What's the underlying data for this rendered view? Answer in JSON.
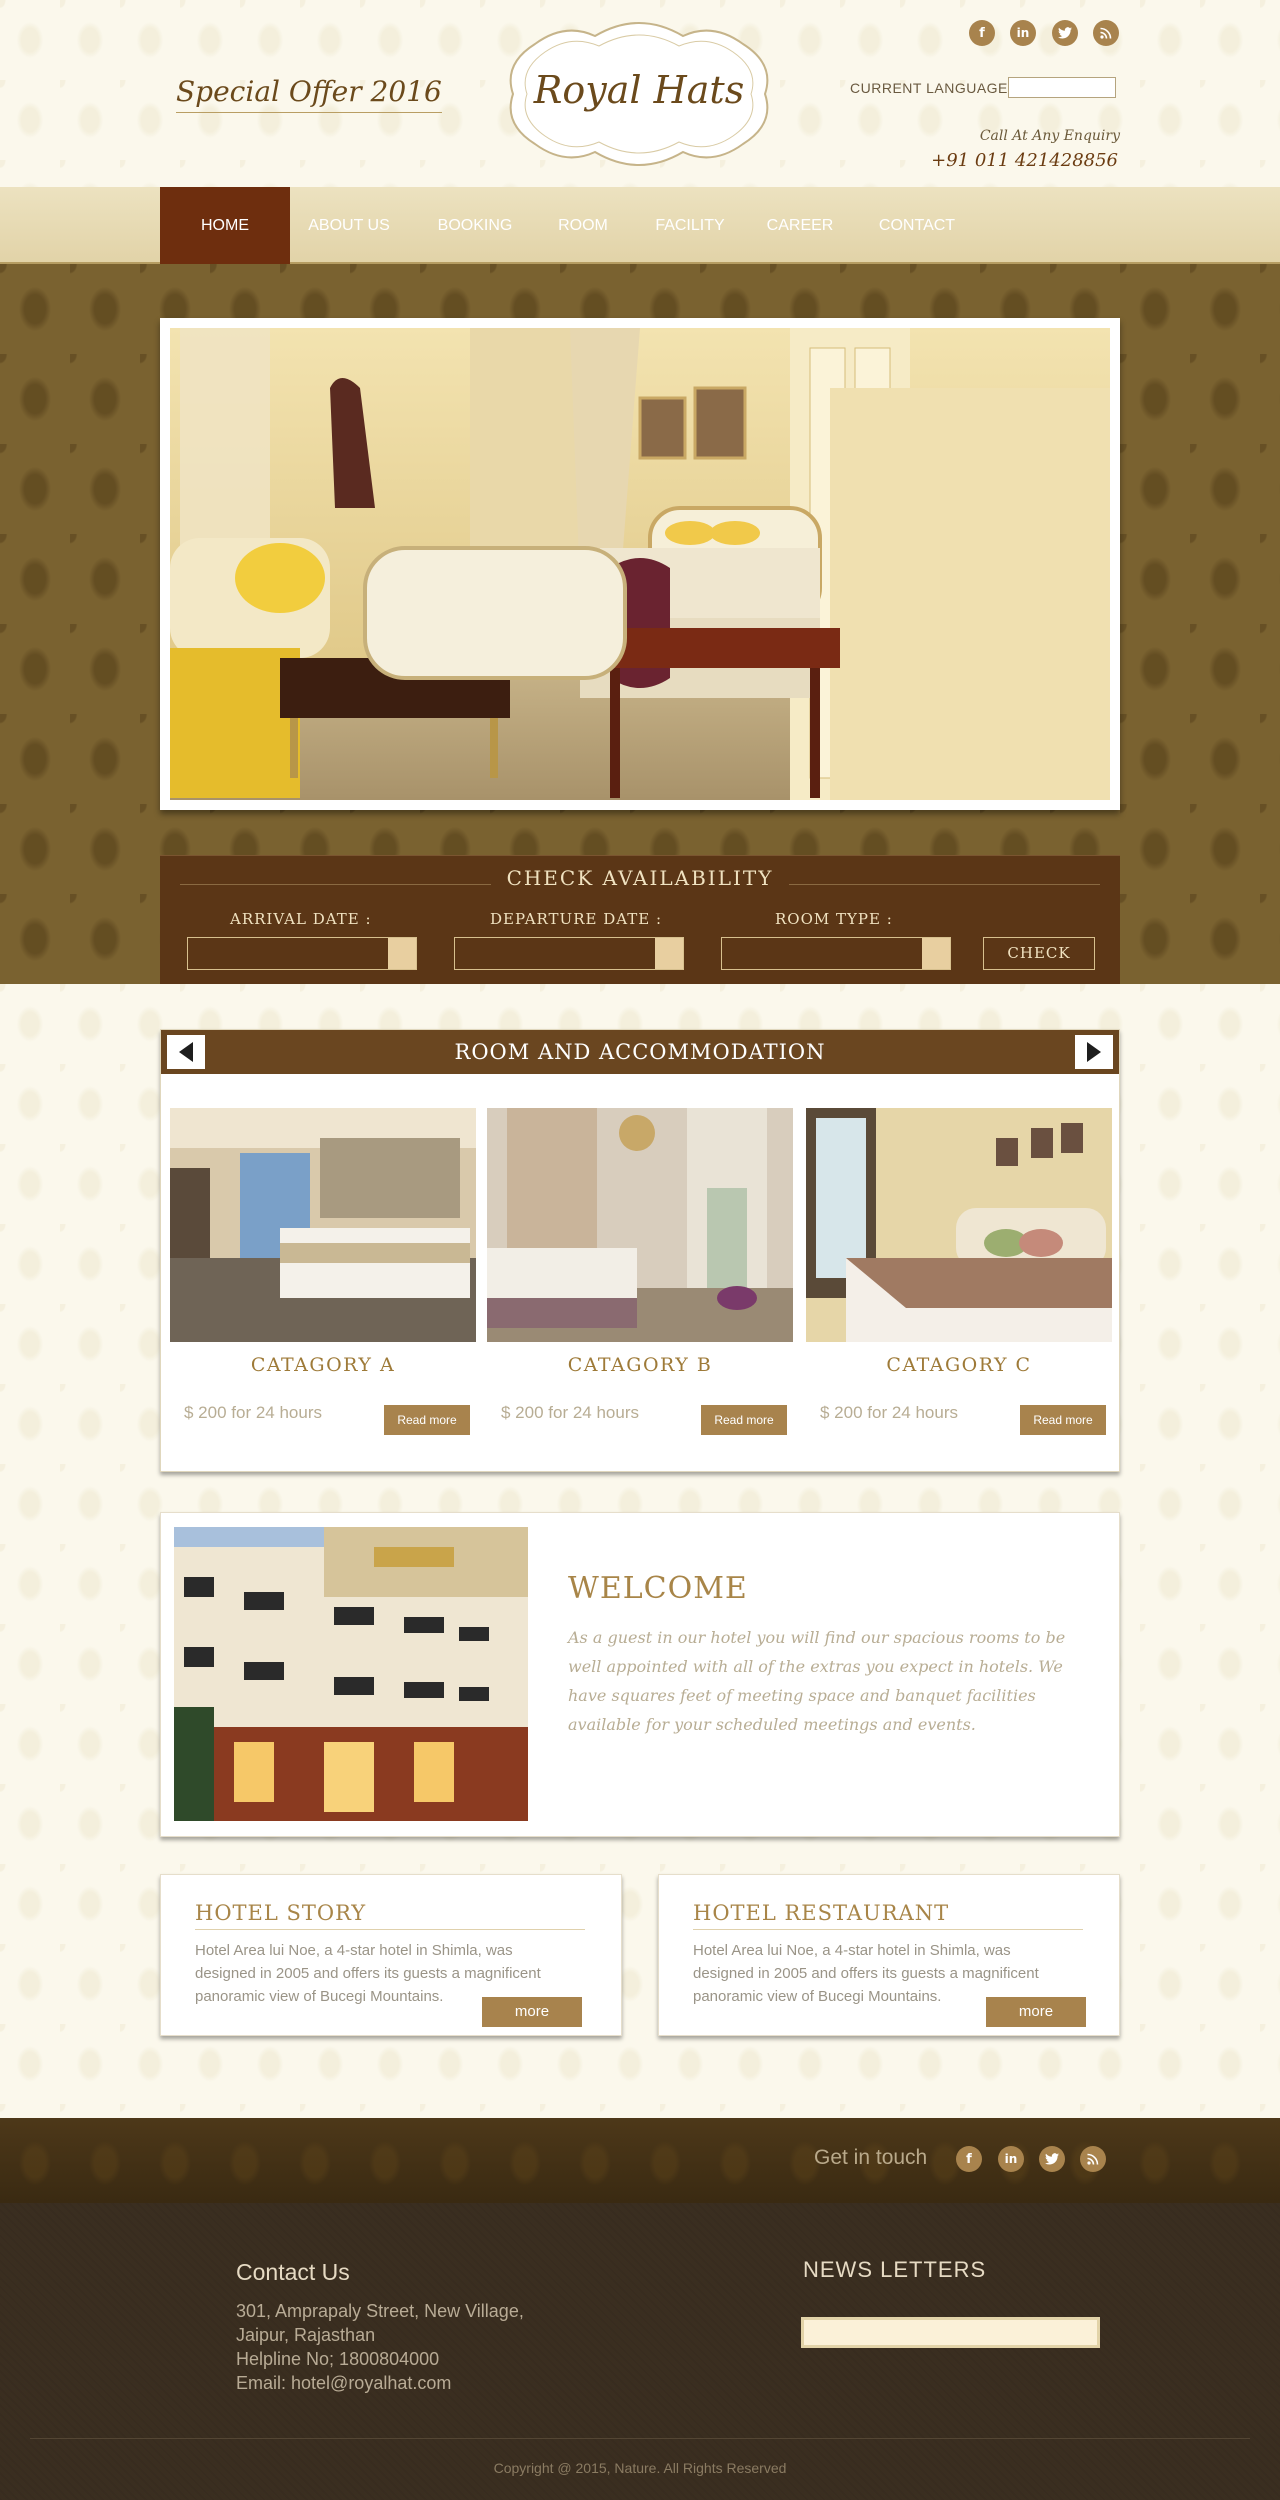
{
  "header": {
    "special_offer": "Special Offer 2016",
    "logo_text": "Royal Hats",
    "language_label": "CURRENT LANGUAGE",
    "language_value": "",
    "enquiry_label": "Call At Any Enquiry",
    "phone": "+91 011 421428856",
    "social_icons": [
      "facebook-icon",
      "linkedin-icon",
      "twitter-icon",
      "rss-icon"
    ]
  },
  "nav": {
    "items": [
      "HOME",
      "ABOUT US",
      "BOOKING",
      "ROOM",
      "FACILITY",
      "CAREER",
      "CONTACT"
    ],
    "active": "HOME"
  },
  "check": {
    "title": "CHECK  AVAILABILITY",
    "arrival_label": "ARRIVAL DATE :",
    "departure_label": "DEPARTURE DATE :",
    "room_type_label": "ROOM TYPE :",
    "button": "CHECK"
  },
  "rooms": {
    "title": "ROOM AND ACCOMMODATION",
    "cards": [
      {
        "name": "CATAGORY A",
        "price": "$ 200 for 24 hours",
        "button": "Read more"
      },
      {
        "name": "CATAGORY B",
        "price": "$ 200 for 24 hours",
        "button": "Read more"
      },
      {
        "name": "CATAGORY C",
        "price": "$ 200 for 24 hours",
        "button": "Read more"
      }
    ]
  },
  "welcome": {
    "title": "WELCOME",
    "text": "As a guest in our hotel you will find our spacious rooms to be well appointed with all of the extras you expect in hotels. We have squares feet of meeting space and banquet facilities available for your scheduled meetings and events."
  },
  "story": {
    "title": "HOTEL STORY",
    "text": "Hotel Area lui Noe, a 4-star hotel in Shimla, was designed in 2005 and offers its guests a magnificent panoramic view of Bucegi Mountains.",
    "button": "more"
  },
  "restaurant": {
    "title": "HOTEL RESTAURANT",
    "text": "Hotel Area lui Noe, a 4-star hotel in Shimla, was designed in 2005 and offers its guests a magnificent panoramic view of Bucegi Mountains.",
    "button": "more"
  },
  "footer": {
    "get_in_touch": "Get in touch",
    "contact_heading": "Contact Us",
    "address_line1": "301, Amprapaly Street, New Village,",
    "address_line2": "Jaipur, Rajasthan",
    "helpline": "Helpline No; 1800804000",
    "email": "Email: hotel@royalhat.com",
    "news_heading": "NEWS LETTERS",
    "copyright": "Copyright @ 2015, Nature. All Rights Reserved"
  },
  "colors": {
    "brand_brown": "#6e2e0e",
    "gold": "#a8834d",
    "cream": "#fbf8ea"
  }
}
